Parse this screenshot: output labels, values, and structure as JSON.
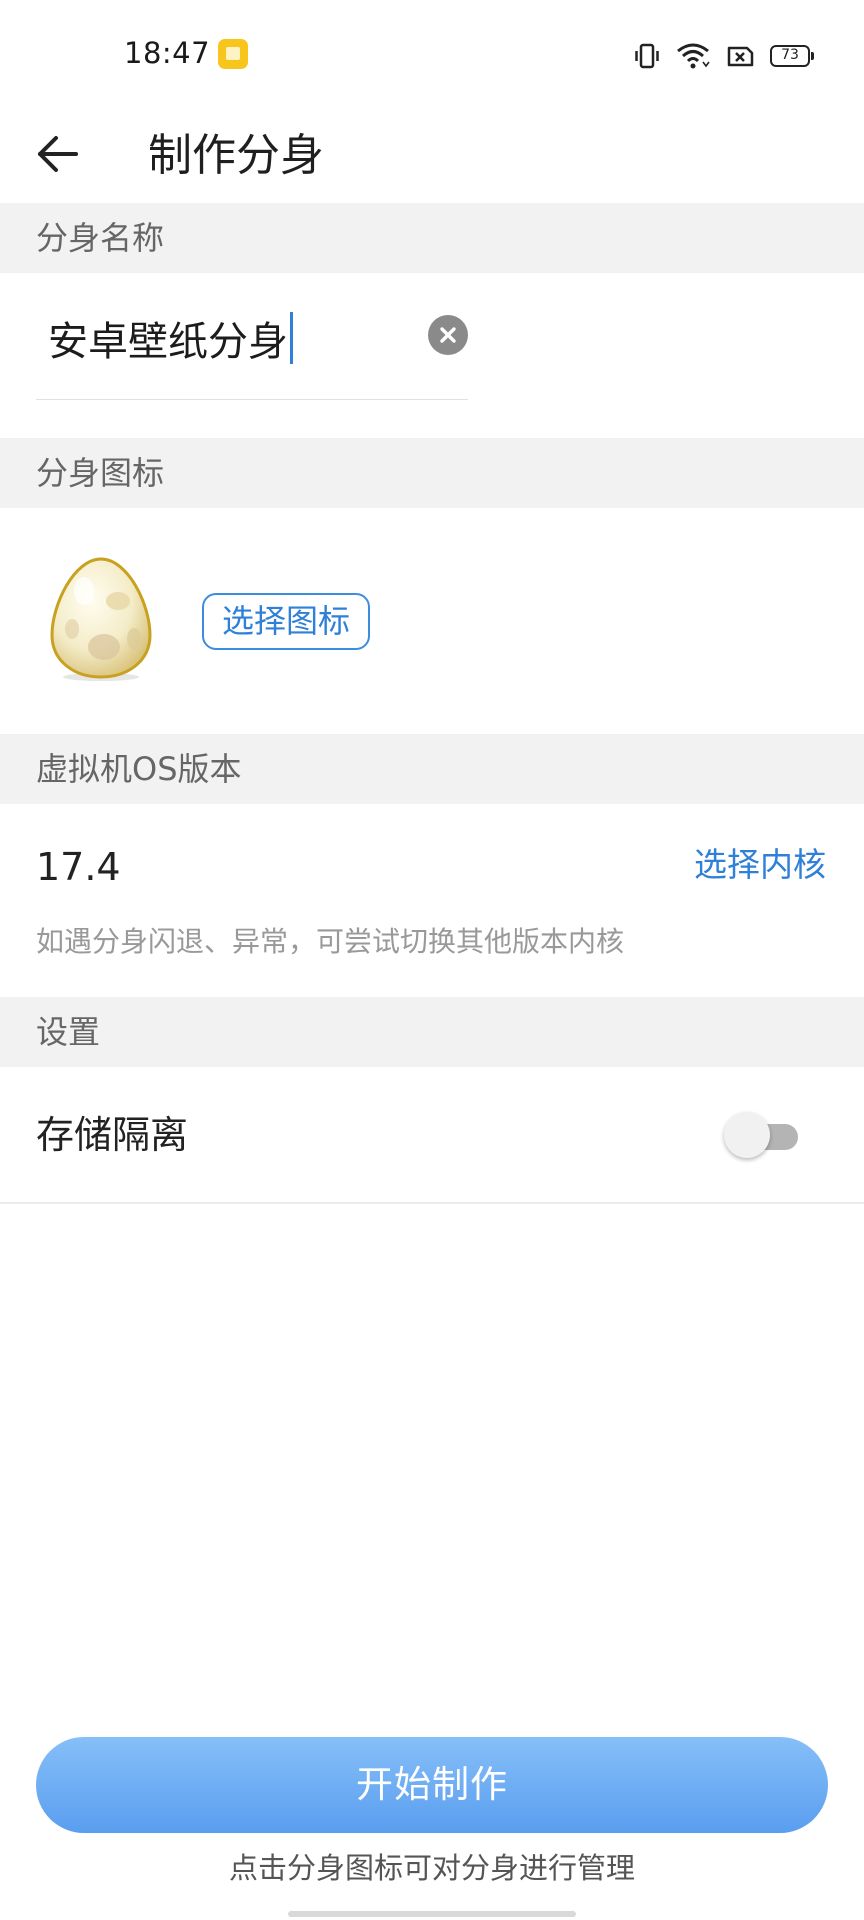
{
  "status_bar": {
    "time": "18:47",
    "notification_icon": "notes-app-icon",
    "icons": [
      "vibrate-icon",
      "wifi-icon",
      "sim-off-icon"
    ],
    "battery": "73"
  },
  "header": {
    "back_icon": "arrow-left-icon",
    "title": "制作分身"
  },
  "sections": {
    "name": {
      "header": "分身名称",
      "input_value": "安卓壁纸分身",
      "clear_icon": "clear-icon"
    },
    "icon": {
      "header": "分身图标",
      "icon_name": "egg-icon",
      "choose_button": "选择图标"
    },
    "os": {
      "header": "虚拟机OS版本",
      "version": "17.4",
      "choose_kernel": "选择内核",
      "hint": "如遇分身闪退、异常，可尝试切换其他版本内核"
    },
    "settings": {
      "header": "设置",
      "storage_isolation_label": "存储隔离",
      "storage_isolation_enabled": false
    }
  },
  "footer": {
    "start_button": "开始制作",
    "hint": "点击分身图标可对分身进行管理"
  },
  "colors": {
    "accent": "#2f80d8",
    "button_gradient_top": "#86bff8",
    "button_gradient_bottom": "#5a9ef0",
    "section_bg": "#f2f2f2"
  }
}
